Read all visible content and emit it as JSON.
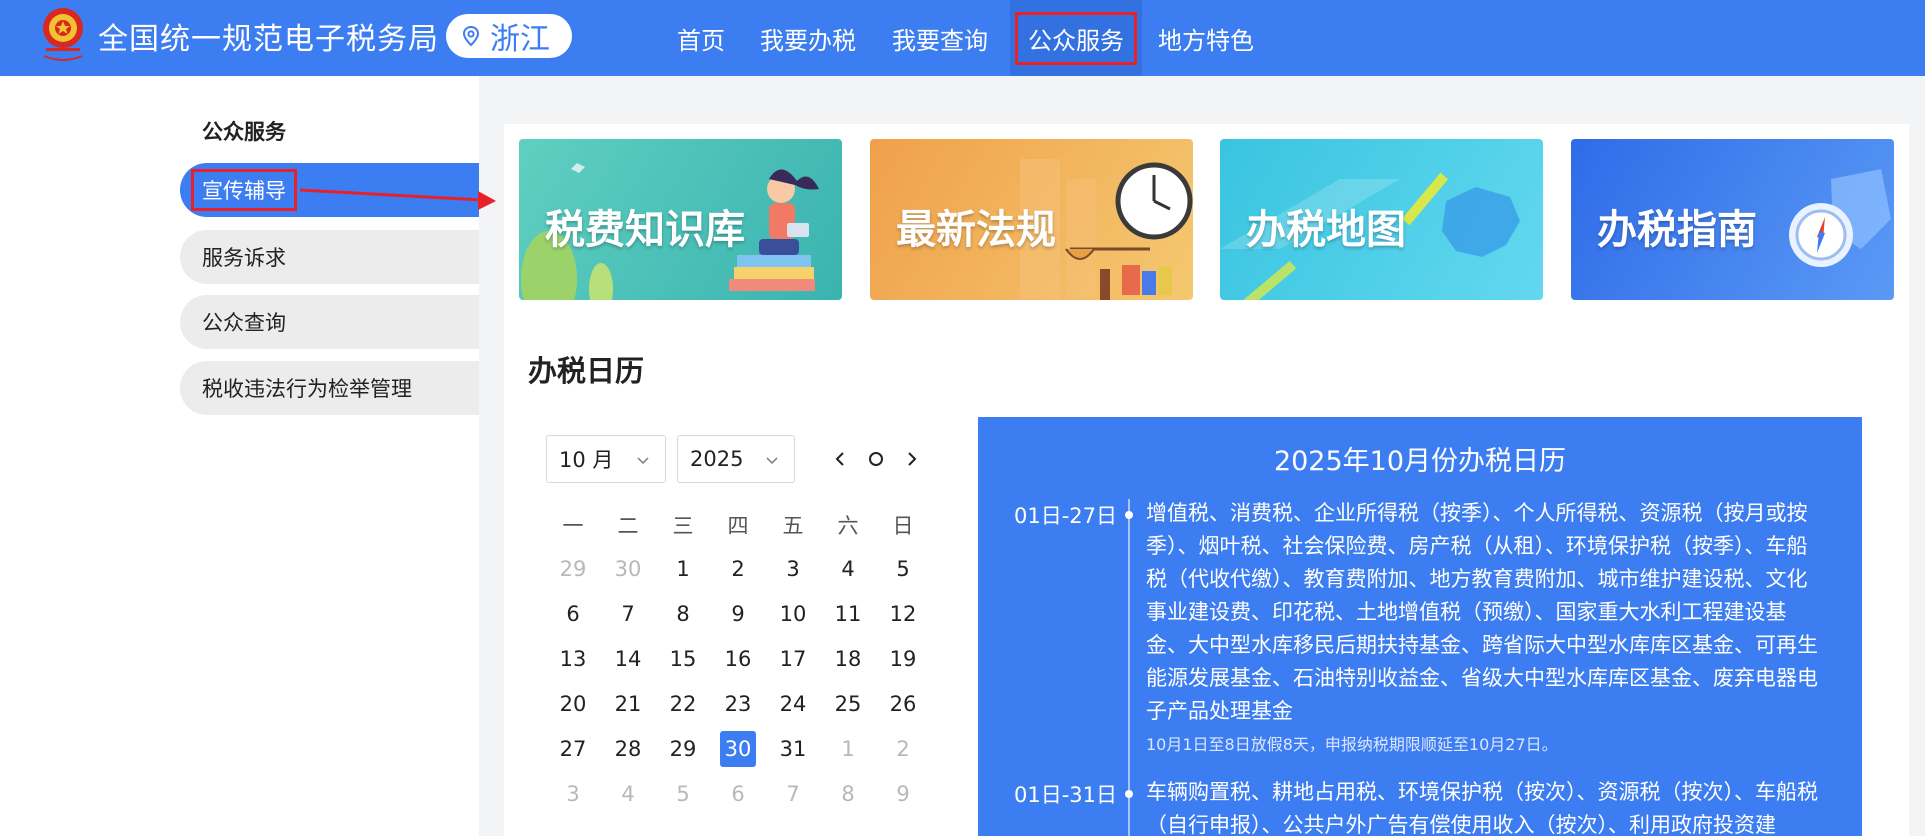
{
  "header": {
    "site_title": "全国统一规范电子税务局",
    "region": "浙江",
    "nav": [
      {
        "label": "首页"
      },
      {
        "label": "我要办税"
      },
      {
        "label": "我要查询"
      },
      {
        "label": "公众服务",
        "active": true
      },
      {
        "label": "地方特色"
      }
    ],
    "colors": {
      "bar": "#3d7df2",
      "highlight_box": "#e8202a"
    }
  },
  "sidebar": {
    "title": "公众服务",
    "items": [
      {
        "label": "宣传辅导",
        "active": true
      },
      {
        "label": "服务诉求"
      },
      {
        "label": "公众查询"
      },
      {
        "label": "税收违法行为检举管理"
      }
    ]
  },
  "banners": [
    {
      "label": "税费知识库",
      "icon": "reading-person-icon"
    },
    {
      "label": "最新法规",
      "icon": "clock-scale-icon"
    },
    {
      "label": "办税地图",
      "icon": "china-map-icon"
    },
    {
      "label": "办税指南",
      "icon": "compass-icon"
    }
  ],
  "calendar": {
    "section_title": "办税日历",
    "month_select": "10 月",
    "year_select": "2025",
    "weekdays": [
      "一",
      "二",
      "三",
      "四",
      "五",
      "六",
      "日"
    ],
    "weeks": [
      [
        {
          "d": "29",
          "m": true
        },
        {
          "d": "30",
          "m": true
        },
        {
          "d": "1"
        },
        {
          "d": "2"
        },
        {
          "d": "3"
        },
        {
          "d": "4"
        },
        {
          "d": "5"
        }
      ],
      [
        {
          "d": "6"
        },
        {
          "d": "7"
        },
        {
          "d": "8"
        },
        {
          "d": "9"
        },
        {
          "d": "10"
        },
        {
          "d": "11"
        },
        {
          "d": "12"
        }
      ],
      [
        {
          "d": "13"
        },
        {
          "d": "14"
        },
        {
          "d": "15"
        },
        {
          "d": "16"
        },
        {
          "d": "17"
        },
        {
          "d": "18"
        },
        {
          "d": "19"
        }
      ],
      [
        {
          "d": "20"
        },
        {
          "d": "21"
        },
        {
          "d": "22"
        },
        {
          "d": "23"
        },
        {
          "d": "24"
        },
        {
          "d": "25"
        },
        {
          "d": "26"
        }
      ],
      [
        {
          "d": "27"
        },
        {
          "d": "28"
        },
        {
          "d": "29"
        },
        {
          "d": "30",
          "t": true
        },
        {
          "d": "31"
        },
        {
          "d": "1",
          "m": true
        },
        {
          "d": "2",
          "m": true
        }
      ],
      [
        {
          "d": "3",
          "m": true
        },
        {
          "d": "4",
          "m": true
        },
        {
          "d": "5",
          "m": true
        },
        {
          "d": "6",
          "m": true
        },
        {
          "d": "7",
          "m": true
        },
        {
          "d": "8",
          "m": true
        },
        {
          "d": "9",
          "m": true
        }
      ]
    ]
  },
  "tax_calendar": {
    "title": "2025年10月份办税日历",
    "entries": [
      {
        "date": "01日-27日",
        "text": "增值税、消费税、企业所得税（按季）、个人所得税、资源税（按月或按季）、烟叶税、社会保险费、房产税（从租）、环境保护税（按季）、车船税（代收代缴）、教育费附加、地方教育费附加、城市维护建设税、文化事业建设费、印花税、土地增值税（预缴）、国家重大水利工程建设基金、大中型水库移民后期扶持基金、跨省际大中型水库库区基金、可再生能源发展基金、石油特别收益金、省级大中型水库库区基金、废弃电器电子产品处理基金",
        "note": "10月1日至8日放假8天，申报纳税期限顺延至10月27日。"
      },
      {
        "date": "01日-31日",
        "text": "车辆购置税、耕地占用税、环境保护税（按次）、资源税（按次）、车船税（自行申报）、公共户外广告有偿使用收入（按次）、利用政府投资建",
        "note": ""
      }
    ]
  }
}
